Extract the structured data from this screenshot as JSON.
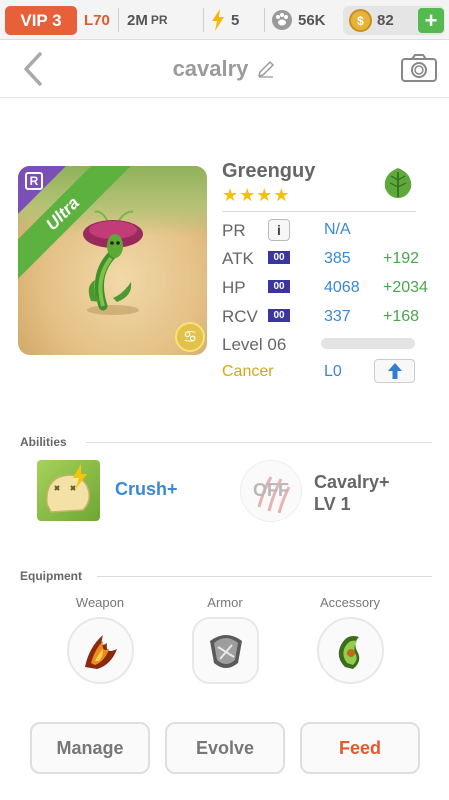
{
  "status_bar": {
    "vip": "VIP 3",
    "level": "L70",
    "pr_value": "2M",
    "pr_label": "PR",
    "energy": "5",
    "paws": "56K",
    "coins": "82",
    "add_label": "+"
  },
  "header": {
    "title": "cavalry"
  },
  "monster": {
    "name": "Greenguy",
    "stars": "★★★★",
    "rarity": "Ultra",
    "rank_badge": "R",
    "element": "leaf-icon",
    "zodiac_symbol": "♋"
  },
  "stats": {
    "pr_label": "PR",
    "pr_value": "N/A",
    "info_label": "i",
    "badge": "00",
    "rows": [
      {
        "label": "ATK",
        "value": "385",
        "bonus": "+192"
      },
      {
        "label": "HP",
        "value": "4068",
        "bonus": "+2034"
      },
      {
        "label": "RCV",
        "value": "337",
        "bonus": "+168"
      }
    ],
    "level_label": "Level 06",
    "level_progress": 0.0,
    "zodiac": "Cancer",
    "zodiac_level": "L0"
  },
  "abilities": {
    "title": "Abilities",
    "active_name": "Crush+",
    "passive_state": "OFF",
    "passive_name": "Cavalry+",
    "passive_level": "LV 1"
  },
  "equipment": {
    "title": "Equipment",
    "slots": [
      {
        "label": "Weapon"
      },
      {
        "label": "Armor"
      },
      {
        "label": "Accessory"
      }
    ]
  },
  "actions": {
    "manage": "Manage",
    "evolve": "Evolve",
    "feed": "Feed"
  },
  "colors": {
    "accent_orange": "#e05a2e",
    "stat_blue": "#3b88d3",
    "bonus_green": "#45a84a",
    "star_gold": "#f2c10c",
    "ultra_green": "#5cb13f"
  }
}
